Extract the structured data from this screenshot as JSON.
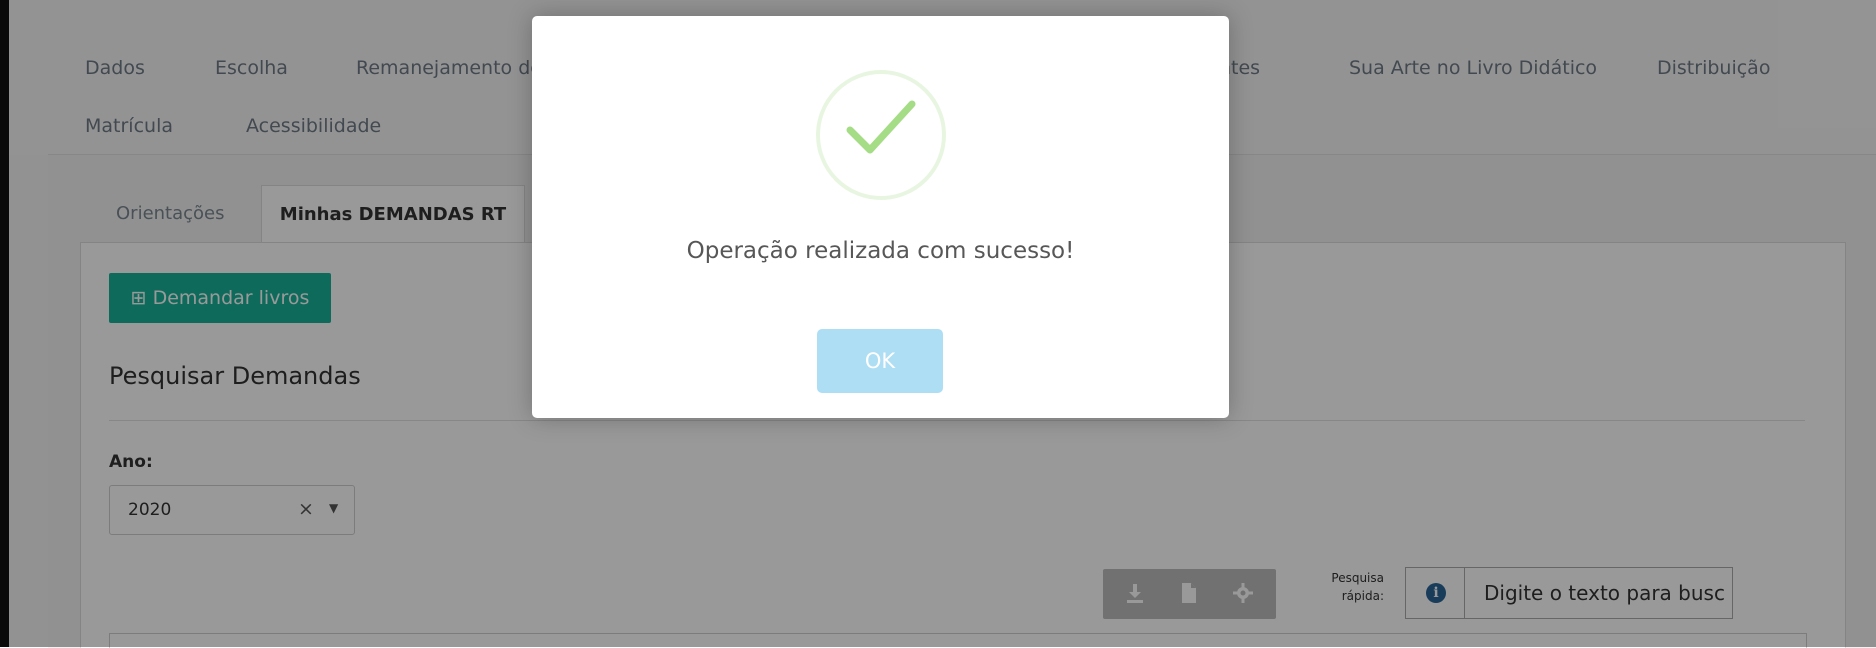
{
  "nav": {
    "row1": [
      "Dados",
      "Escolha",
      "Remanejamento de",
      "ntes",
      "Sua Arte no Livro Didático",
      "Distribuição"
    ],
    "row2": [
      "Matrícula",
      "Acessibilidade"
    ]
  },
  "tabs": {
    "orientacoes": "Orientações",
    "minhas": "Minhas DEMANDAS RT"
  },
  "main": {
    "demand_button": "⊞ Demandar livros",
    "section_title": "Pesquisar Demandas",
    "ano_label": "Ano:",
    "ano_value": "2020",
    "quick_search_label_1": "Pesquisa",
    "quick_search_label_2": "rápida:",
    "search_text": "Digite o texto para busc"
  },
  "icons": {
    "download": "download-icon",
    "file": "file-icon",
    "gear": "gear-icon",
    "info": "info-icon",
    "check": "check-icon"
  },
  "modal": {
    "message": "Operação realizada com sucesso!",
    "ok_label": "OK"
  },
  "colors": {
    "accent_green": "#18b39a",
    "ok_button": "#aedef4",
    "check": "#a5dc86"
  }
}
